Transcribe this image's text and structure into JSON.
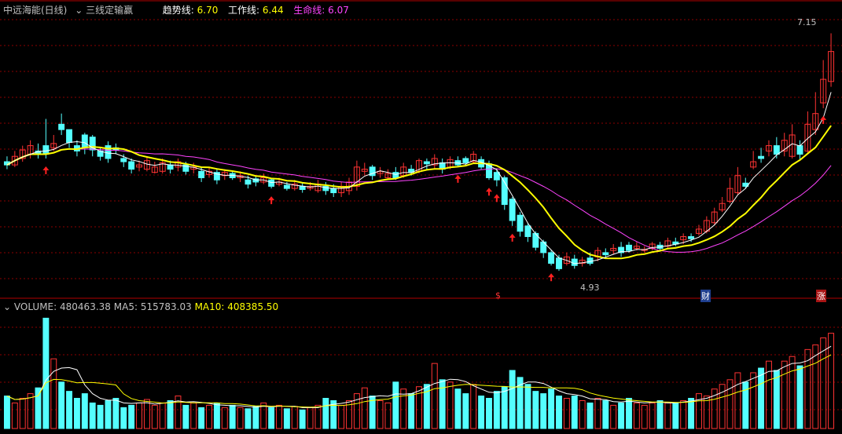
{
  "header": {
    "stock_name": "中远海能(日线)",
    "indicator_name": "三线定输赢",
    "trend_label": "趋势线:",
    "trend_value": "6.70",
    "work_label": "工作线:",
    "work_value": "6.44",
    "life_label": "生命线:",
    "life_value": "6.07"
  },
  "volume_header": {
    "volume_label": "VOLUME:",
    "volume_value": "480463.38",
    "ma5_label": "MA5:",
    "ma5_value": "515783.03",
    "ma10_label": "MA10:",
    "ma10_value": "408385.50"
  },
  "annotations": {
    "high_label": "7.15",
    "low_label": "4.93",
    "markers": [
      "$",
      "财",
      "涨"
    ]
  },
  "colors": {
    "up": "#ff3333",
    "down": "#54ffff",
    "trend_line": "#ffff00",
    "work_line": "#ffffff",
    "life_line": "#ff44ff",
    "grid": "#8b0000"
  },
  "chart_data": {
    "type": "candlestick",
    "series_price": {
      "open": [
        5.95,
        5.92,
        5.98,
        6.02,
        6.05,
        6.1,
        6.08,
        6.3,
        6.25,
        6.1,
        6.2,
        6.18,
        6.05,
        6.1,
        6.08,
        5.98,
        5.95,
        5.9,
        5.88,
        5.85,
        5.86,
        5.92,
        5.9,
        5.92,
        5.88,
        5.86,
        5.83,
        5.85,
        5.82,
        5.84,
        5.8,
        5.78,
        5.79,
        5.76,
        5.78,
        5.74,
        5.73,
        5.7,
        5.72,
        5.7,
        5.68,
        5.72,
        5.7,
        5.66,
        5.68,
        5.72,
        5.86,
        5.9,
        5.84,
        5.8,
        5.85,
        5.82,
        5.88,
        5.86,
        5.95,
        5.92,
        5.94,
        5.9,
        5.96,
        5.98,
        5.95,
        5.97,
        5.93,
        5.85,
        5.8,
        5.6,
        5.45,
        5.35,
        5.28,
        5.2,
        5.1,
        5.05,
        5.0,
        5.04,
        5.0,
        5.05,
        5.06,
        5.1,
        5.12,
        5.15,
        5.17,
        5.14,
        5.12,
        5.14,
        5.17,
        5.16,
        5.2,
        5.22,
        5.25,
        5.28,
        5.3,
        5.38,
        5.5,
        5.58,
        5.66,
        5.75,
        5.9,
        6.0,
        6.05,
        6.1,
        6.05,
        6.0,
        6.1,
        6.05,
        6.25,
        6.5,
        6.7
      ],
      "close": [
        5.92,
        6.0,
        6.06,
        6.1,
        6.02,
        6.02,
        6.12,
        6.25,
        6.13,
        6.05,
        6.08,
        6.06,
        6.0,
        5.98,
        6.06,
        5.95,
        5.88,
        5.92,
        5.96,
        5.9,
        5.94,
        5.88,
        5.95,
        5.86,
        5.9,
        5.8,
        5.86,
        5.78,
        5.85,
        5.8,
        5.82,
        5.74,
        5.76,
        5.8,
        5.72,
        5.76,
        5.7,
        5.74,
        5.69,
        5.72,
        5.74,
        5.68,
        5.66,
        5.72,
        5.76,
        5.9,
        5.88,
        5.82,
        5.86,
        5.84,
        5.8,
        5.9,
        5.85,
        5.96,
        5.93,
        5.98,
        5.88,
        5.97,
        5.92,
        5.94,
        6.02,
        5.9,
        5.8,
        5.78,
        5.55,
        5.4,
        5.3,
        5.25,
        5.15,
        5.1,
        5.0,
        4.95,
        5.06,
        4.98,
        5.03,
        5.0,
        5.12,
        5.08,
        5.14,
        5.1,
        5.12,
        5.16,
        5.13,
        5.18,
        5.14,
        5.21,
        5.18,
        5.25,
        5.23,
        5.32,
        5.4,
        5.48,
        5.56,
        5.7,
        5.82,
        5.72,
        5.95,
        5.98,
        6.1,
        6.02,
        6.15,
        6.2,
        6.02,
        6.3,
        6.4,
        6.72,
        6.98
      ],
      "high": [
        6.0,
        6.05,
        6.1,
        6.15,
        6.12,
        6.35,
        6.2,
        6.4,
        6.2,
        6.15,
        6.22,
        6.2,
        6.08,
        6.14,
        6.12,
        6.02,
        5.98,
        5.96,
        6.0,
        5.95,
        5.98,
        5.96,
        5.98,
        5.95,
        5.94,
        5.9,
        5.9,
        5.88,
        5.88,
        5.86,
        5.86,
        5.82,
        5.82,
        5.84,
        5.8,
        5.8,
        5.76,
        5.78,
        5.75,
        5.76,
        5.78,
        5.76,
        5.74,
        5.76,
        5.8,
        5.96,
        5.94,
        5.92,
        5.9,
        5.88,
        5.9,
        5.94,
        5.92,
        5.98,
        5.98,
        6.02,
        5.98,
        6.0,
        6.0,
        6.0,
        6.05,
        6.0,
        5.96,
        5.88,
        5.82,
        5.62,
        5.48,
        5.38,
        5.3,
        5.22,
        5.12,
        5.08,
        5.1,
        5.08,
        5.06,
        5.1,
        5.15,
        5.14,
        5.18,
        5.2,
        5.2,
        5.2,
        5.16,
        5.2,
        5.2,
        5.24,
        5.24,
        5.28,
        5.28,
        5.36,
        5.44,
        5.52,
        5.62,
        5.8,
        5.9,
        5.8,
        6.05,
        6.08,
        6.15,
        6.18,
        6.22,
        6.3,
        6.15,
        6.42,
        6.6,
        6.9,
        7.15
      ],
      "low": [
        5.88,
        5.9,
        5.95,
        5.98,
        5.98,
        5.98,
        6.05,
        6.2,
        6.08,
        6.0,
        6.02,
        6.0,
        5.96,
        5.94,
        6.02,
        5.9,
        5.84,
        5.86,
        5.86,
        5.84,
        5.84,
        5.84,
        5.86,
        5.83,
        5.84,
        5.76,
        5.8,
        5.74,
        5.78,
        5.78,
        5.76,
        5.7,
        5.72,
        5.74,
        5.7,
        5.72,
        5.68,
        5.68,
        5.66,
        5.68,
        5.66,
        5.64,
        5.62,
        5.62,
        5.64,
        5.68,
        5.82,
        5.78,
        5.8,
        5.78,
        5.78,
        5.8,
        5.82,
        5.84,
        5.88,
        5.88,
        5.84,
        5.88,
        5.9,
        5.92,
        5.94,
        5.88,
        5.78,
        5.72,
        5.5,
        5.35,
        5.25,
        5.2,
        5.12,
        5.05,
        4.98,
        4.93,
        4.98,
        4.95,
        4.97,
        4.98,
        5.02,
        5.04,
        5.08,
        5.06,
        5.1,
        5.12,
        5.1,
        5.12,
        5.12,
        5.14,
        5.16,
        5.18,
        5.2,
        5.26,
        5.28,
        5.36,
        5.48,
        5.56,
        5.64,
        5.7,
        5.88,
        5.94,
        6.0,
        5.98,
        6.0,
        5.98,
        5.96,
        6.02,
        6.2,
        6.45,
        6.65
      ]
    },
    "volume": [
      28,
      22,
      26,
      30,
      35,
      95,
      60,
      40,
      32,
      26,
      30,
      22,
      20,
      24,
      26,
      18,
      20,
      22,
      25,
      20,
      22,
      24,
      28,
      20,
      22,
      18,
      20,
      22,
      18,
      20,
      18,
      17,
      19,
      22,
      18,
      20,
      17,
      19,
      16,
      18,
      20,
      26,
      24,
      20,
      24,
      30,
      35,
      28,
      24,
      22,
      40,
      34,
      30,
      36,
      38,
      56,
      42,
      40,
      34,
      30,
      38,
      28,
      26,
      32,
      36,
      50,
      44,
      38,
      32,
      30,
      34,
      28,
      26,
      28,
      24,
      22,
      26,
      24,
      20,
      22,
      26,
      22,
      20,
      22,
      24,
      22,
      22,
      24,
      26,
      30,
      28,
      34,
      38,
      42,
      48,
      40,
      48,
      52,
      58,
      50,
      58,
      62,
      54,
      68,
      72,
      78,
      82
    ]
  }
}
